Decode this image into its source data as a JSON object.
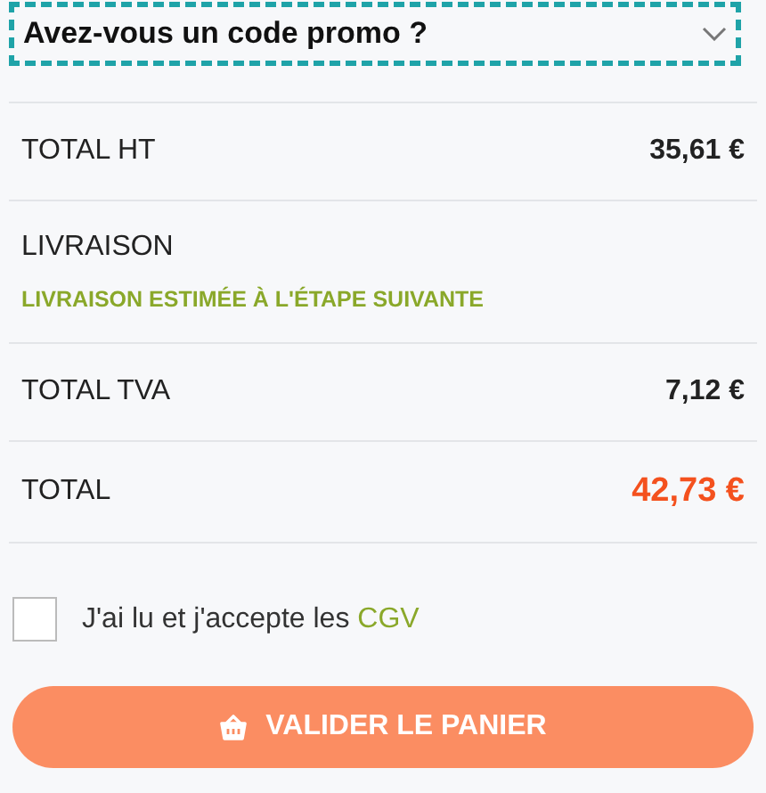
{
  "promo": {
    "label": "Avez-vous un code promo ?",
    "expanded": false
  },
  "summary": [
    {
      "kind": "amount",
      "label": "TOTAL HT",
      "value": "35,61 €"
    },
    {
      "kind": "note",
      "label": "LIVRAISON",
      "note": "LIVRAISON ESTIMÉE À L'ÉTAPE SUIVANTE"
    },
    {
      "kind": "amount",
      "label": "TOTAL TVA",
      "value": "7,12 €"
    },
    {
      "kind": "total",
      "label": "TOTAL",
      "value": "42,73 €"
    }
  ],
  "terms": {
    "text": "J'ai lu et j'accepte les",
    "link": "CGV",
    "checked": false
  },
  "submit": {
    "label": "VALIDER LE PANIER"
  }
}
